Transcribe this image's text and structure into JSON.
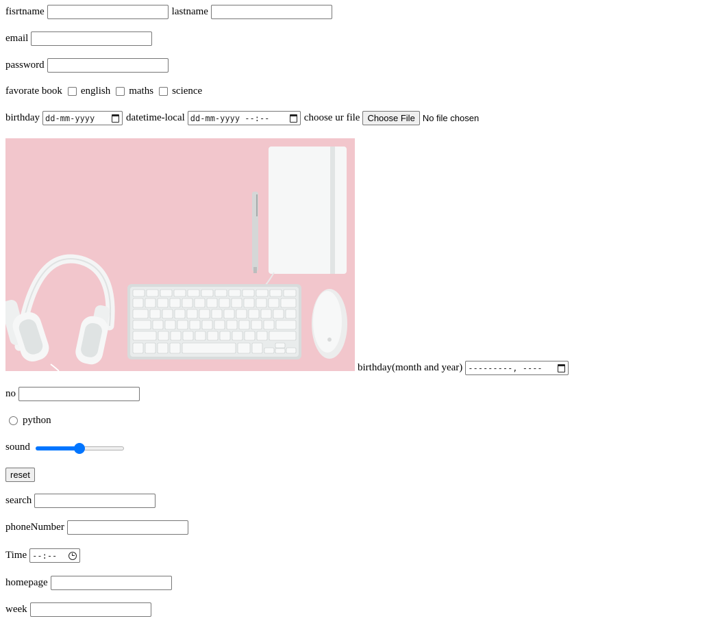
{
  "form": {
    "firstname": {
      "label": "fisrtname",
      "value": ""
    },
    "lastname": {
      "label": "lastname",
      "value": ""
    },
    "email": {
      "label": "email",
      "value": ""
    },
    "password": {
      "label": "password",
      "value": ""
    },
    "favorite_book": {
      "label": "favorate book",
      "options": [
        {
          "label": "english",
          "checked": false
        },
        {
          "label": "maths",
          "checked": false
        },
        {
          "label": "science",
          "checked": false
        }
      ]
    },
    "birthday": {
      "label": "birthday",
      "placeholder": "dd-mm-yyyy"
    },
    "datetime_local": {
      "label": "datetime-local",
      "placeholder": "dd-mm-yyyy --:--"
    },
    "file": {
      "label": "choose ur file",
      "button": "Choose File",
      "status": "No file chosen"
    },
    "month": {
      "label": "birthday(month and year)",
      "placeholder": "---------, ----"
    },
    "number": {
      "label": "no",
      "value": ""
    },
    "radio": {
      "label": "python",
      "checked": false
    },
    "sound": {
      "label": "sound",
      "value_fraction": 0.5
    },
    "reset": {
      "label": "reset"
    },
    "search": {
      "label": "search",
      "value": ""
    },
    "phone": {
      "label": "phoneNumber",
      "value": ""
    },
    "time": {
      "label": "Time",
      "placeholder": "--:--"
    },
    "homepage": {
      "label": "homepage",
      "value": ""
    },
    "week": {
      "label": "week",
      "value": ""
    }
  },
  "colors": {
    "accent": "#0075ff",
    "photo_background": "#f2c6cc"
  },
  "icons": [
    "calendar-icon",
    "clock-icon"
  ]
}
